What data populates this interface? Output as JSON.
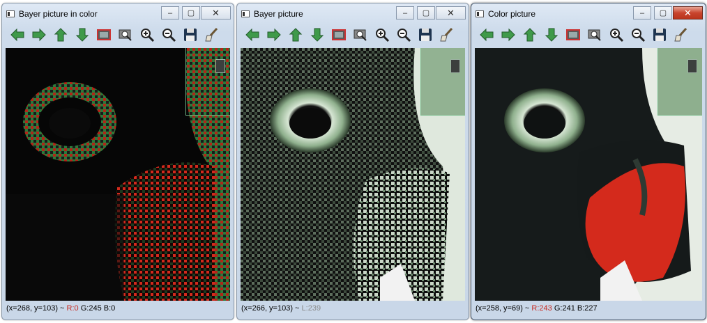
{
  "windows": [
    {
      "title": "Bayer picture in color",
      "status": {
        "coords": "(x=268, y=103) ~",
        "r": "R:0",
        "g": "G:245",
        "b": "B:0"
      }
    },
    {
      "title": "Bayer picture",
      "status": {
        "coords": "(x=266, y=103) ~",
        "l": "L:239"
      }
    },
    {
      "title": "Color picture",
      "status": {
        "coords": "(x=258, y=69) ~",
        "r": "R:243",
        "g": "G:241",
        "b": "B:227"
      }
    }
  ],
  "window_buttons": {
    "minimize": "–",
    "maximize": "▢",
    "close": "✕"
  },
  "toolbar_icons": [
    "arrow-left-icon",
    "arrow-right-icon",
    "arrow-up-icon",
    "arrow-down-icon",
    "save-image-icon",
    "zoom-rect-icon",
    "zoom-in-icon",
    "zoom-out-icon",
    "save-floppy-icon",
    "properties-brush-icon"
  ],
  "colors": {
    "toolbar_green": "#3f9a4a",
    "status_red": "#c8281e",
    "bird_red": "#d42a1c",
    "minimap_green": "#7fa67f"
  }
}
